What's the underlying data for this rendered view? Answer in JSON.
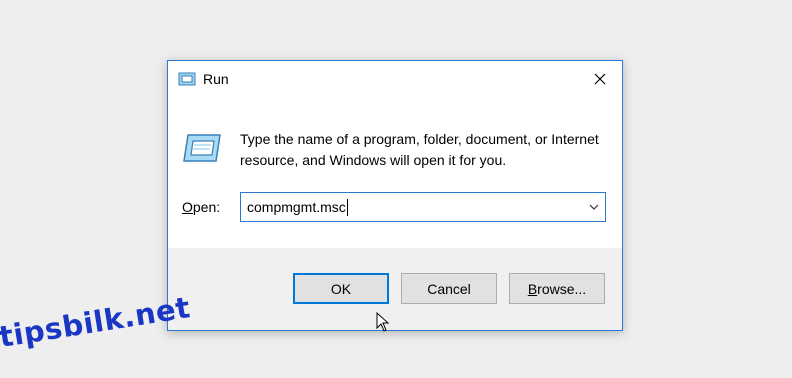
{
  "window": {
    "title": "Run",
    "title_icon": "run-icon",
    "close_icon": "close-icon"
  },
  "content": {
    "icon": "run-icon",
    "description": "Type the name of a program, folder, document, or Internet resource, and Windows will open it for you.",
    "open_label_mnemonic": "O",
    "open_label_rest": "pen:",
    "open_value": "compmgmt.msc",
    "dropdown_icon": "chevron-down-icon"
  },
  "buttons": {
    "ok": "OK",
    "cancel": "Cancel",
    "browse_mnemonic": "B",
    "browse_rest": "rowse..."
  },
  "watermark": "tipsbilk.net",
  "colors": {
    "accent": "#0078d7",
    "window_border": "#2b79d0",
    "footer_bg": "#f0f0f0",
    "watermark": "#1a36c4"
  }
}
